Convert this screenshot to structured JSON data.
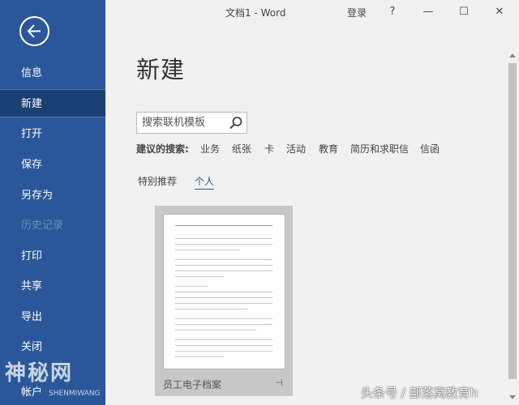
{
  "window": {
    "title": "文档1  -  Word",
    "login": "登录",
    "help": "?",
    "minimize": "—",
    "maximize": "☐",
    "close": "✕"
  },
  "sidebar": {
    "bg_color": "#2b579a",
    "items": [
      {
        "label": "信息",
        "state": "normal"
      },
      {
        "label": "新建",
        "state": "active"
      },
      {
        "label": "打开",
        "state": "normal"
      },
      {
        "label": "保存",
        "state": "normal"
      },
      {
        "label": "另存为",
        "state": "normal"
      },
      {
        "label": "历史记录",
        "state": "disabled"
      },
      {
        "label": "打印",
        "state": "normal"
      },
      {
        "label": "共享",
        "state": "normal"
      },
      {
        "label": "导出",
        "state": "normal"
      },
      {
        "label": "关闭",
        "state": "normal"
      },
      {
        "label": "帐户",
        "state": "normal"
      }
    ]
  },
  "main": {
    "page_title": "新建",
    "search": {
      "placeholder": "搜索联机模板",
      "icon": "search-icon"
    },
    "suggested": {
      "label": "建议的搜索:",
      "items": [
        "业务",
        "纸张",
        "卡",
        "活动",
        "教育",
        "简历和求职信",
        "信函"
      ]
    },
    "tabs": [
      {
        "label": "特别推荐",
        "active": false
      },
      {
        "label": "个人",
        "active": true
      }
    ],
    "templates": [
      {
        "name": "员工电子档案",
        "pin_icon": "pin-icon"
      }
    ]
  },
  "watermarks": {
    "left": "神秘网",
    "left_sub": "SHENMIWANG",
    "right": "头条号 / 部落窝教育h"
  }
}
